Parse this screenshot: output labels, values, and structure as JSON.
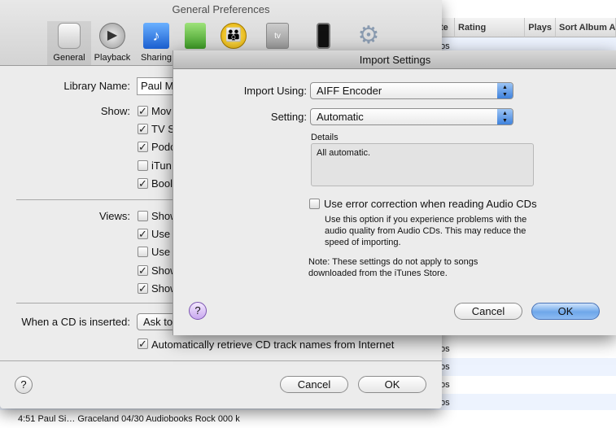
{
  "background_table": {
    "headers": [
      "te",
      "Rating",
      "Plays",
      "Sort Album A"
    ],
    "row_fragments": [
      "os",
      "os",
      "os",
      "os",
      "os"
    ],
    "bottom_row": "4:51  Paul Si…        Graceland 04/30        Audiobooks        Rock        000 k"
  },
  "prefs": {
    "title": "General Preferences",
    "toolbar": [
      {
        "label": "General",
        "icon": "general-switch-icon",
        "selected": true
      },
      {
        "label": "Playback",
        "icon": "playback-icon"
      },
      {
        "label": "Sharing",
        "icon": "sharing-icon"
      },
      {
        "label": "",
        "icon": "store-bag-icon"
      },
      {
        "label": "",
        "icon": "parental-icon"
      },
      {
        "label": "",
        "icon": "apple-tv-icon",
        "text": "tv"
      },
      {
        "label": "",
        "icon": "iphone-icon"
      },
      {
        "label": "",
        "icon": "gear-icon"
      }
    ],
    "library_name_label": "Library Name:",
    "library_name_value": "Paul M",
    "show_label": "Show:",
    "show_items": [
      {
        "label": "Mov",
        "checked": true
      },
      {
        "label": "TV S",
        "checked": true
      },
      {
        "label": "Podc",
        "checked": true
      },
      {
        "label": "iTun",
        "checked": false
      },
      {
        "label": "Bool",
        "checked": true
      }
    ],
    "views_label": "Views:",
    "views_items": [
      {
        "label": "Show",
        "checked": false
      },
      {
        "label": "Use",
        "checked": true
      },
      {
        "label": "Use",
        "checked": false
      },
      {
        "label": "Show",
        "checked": true
      },
      {
        "label": "Show",
        "checked": true
      }
    ],
    "cd_label": "When a CD is inserted:",
    "cd_value": "Ask to",
    "auto_retrieve": {
      "label": "Automatically retrieve CD track names from Internet",
      "checked": true
    },
    "help": "?",
    "cancel": "Cancel",
    "ok": "OK"
  },
  "import": {
    "title": "Import Settings",
    "import_using_label": "Import Using:",
    "import_using_value": "AIFF Encoder",
    "setting_label": "Setting:",
    "setting_value": "Automatic",
    "details_label": "Details",
    "details_text": "All automatic.",
    "error_correction": {
      "label": "Use error correction when reading Audio CDs",
      "checked": false
    },
    "desc_lines": [
      "Use this option if you experience problems with the",
      "audio quality from Audio CDs.  This may reduce the",
      "speed of importing."
    ],
    "note_lines": [
      "Note: These settings do not apply to songs",
      "downloaded from the iTunes Store."
    ],
    "help": "?",
    "cancel": "Cancel",
    "ok": "OK"
  },
  "colors": {
    "accent": "#6ea7ea",
    "window": "#ececec"
  }
}
